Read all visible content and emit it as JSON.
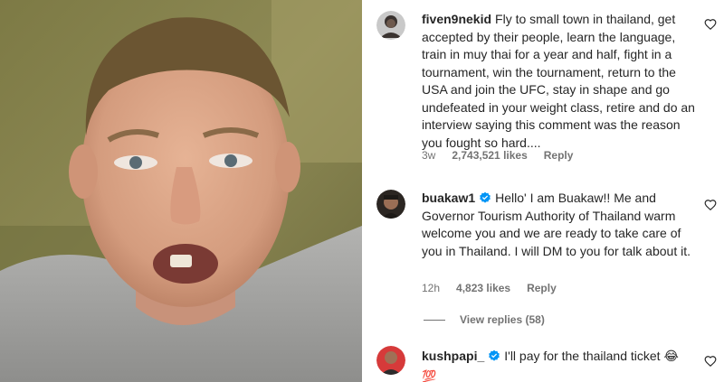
{
  "comments": [
    {
      "username": "fiven9nekid",
      "verified": false,
      "text": "Fly to small town in thailand, get accepted by their people, learn the language, train in muy thai for a year and half, fight in a tournament, win the tournament, return to the USA and join the UFC, stay in shape and go undefeated in your weight class, retire and do an interview saying this comment was the reason you fought so hard....",
      "time": "3w",
      "likes": "2,743,521 likes",
      "reply_label": "Reply",
      "avatar_icon": "user-avatar-icon"
    },
    {
      "username": "buakaw1",
      "verified": true,
      "text": "Hello' I am Buakaw!! Me and Governor Tourism Authority of Thailand warm welcome you and we are ready to take care of you in Thailand. I will DM to you for talk about it.",
      "time": "12h",
      "likes": "4,823 likes",
      "reply_label": "Reply",
      "view_replies": "View replies (58)",
      "avatar_icon": "user-avatar-icon"
    },
    {
      "username": "kushpapi_",
      "verified": true,
      "text": "I'll pay for the thailand ticket 😂",
      "emoji_line": "💯",
      "avatar_icon": "user-avatar-icon"
    }
  ],
  "colors": {
    "text": "#262626",
    "secondary": "#737373",
    "verified": "#0095f6"
  }
}
